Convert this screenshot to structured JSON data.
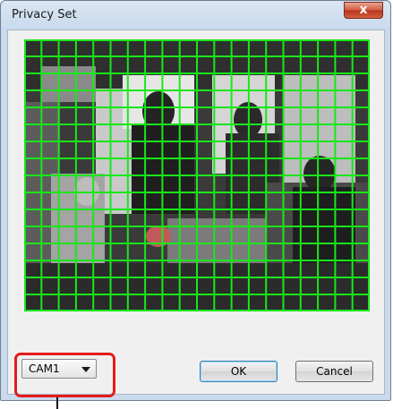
{
  "window": {
    "title": "Privacy Set",
    "close_glyph": "x"
  },
  "video": {
    "grid_columns": 20,
    "grid_rows": 16,
    "grid_color": "#18e818"
  },
  "camera_select": {
    "value": "CAM1",
    "icon": "chevron-down-icon"
  },
  "buttons": {
    "ok": "OK",
    "cancel": "Cancel"
  },
  "annotation": {
    "highlight_color": "#e41c1c"
  }
}
